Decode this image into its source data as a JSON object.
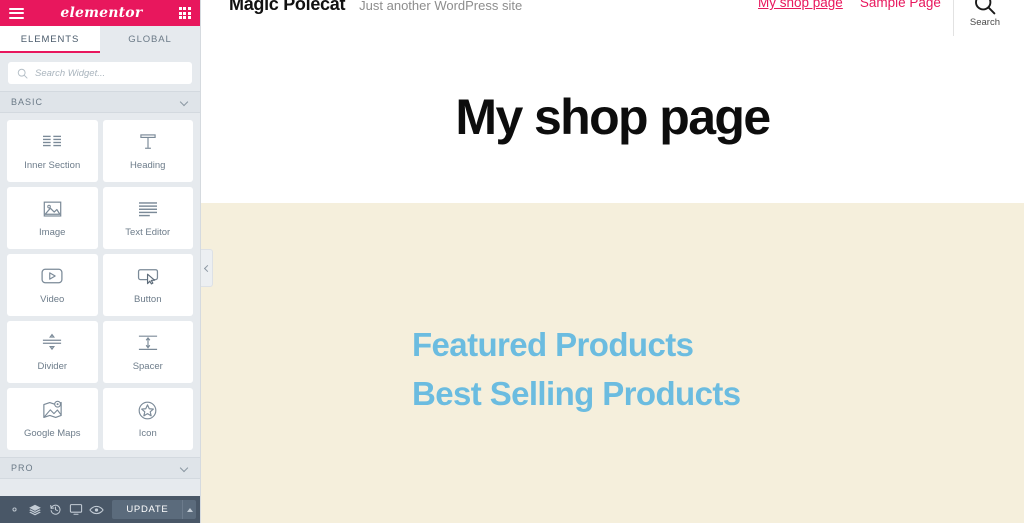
{
  "panel": {
    "brand": "elementor",
    "menu_icon": "hamburger-icon",
    "apps_icon": "grid-apps-icon",
    "tabs": [
      {
        "label": "ELEMENTS",
        "active": true
      },
      {
        "label": "GLOBAL",
        "active": false
      }
    ],
    "search": {
      "placeholder": "Search Widget...",
      "value": "",
      "icon": "search-icon"
    },
    "sections": [
      {
        "label": "BASIC",
        "expanded": true
      },
      {
        "label": "PRO",
        "expanded": false
      }
    ],
    "widgets": [
      {
        "label": "Inner Section",
        "icon": "inner-section-icon"
      },
      {
        "label": "Heading",
        "icon": "heading-t-icon"
      },
      {
        "label": "Image",
        "icon": "image-icon"
      },
      {
        "label": "Text Editor",
        "icon": "text-editor-icon"
      },
      {
        "label": "Video",
        "icon": "video-play-icon"
      },
      {
        "label": "Button",
        "icon": "button-cursor-icon"
      },
      {
        "label": "Divider",
        "icon": "divider-icon"
      },
      {
        "label": "Spacer",
        "icon": "spacer-icon"
      },
      {
        "label": "Google Maps",
        "icon": "google-maps-icon"
      },
      {
        "label": "Icon",
        "icon": "star-circle-icon"
      }
    ],
    "footer": {
      "buttons": [
        {
          "name": "settings-gear-icon",
          "title": "Settings"
        },
        {
          "name": "navigator-layers-icon",
          "title": "Navigator"
        },
        {
          "name": "history-revisions-icon",
          "title": "History"
        },
        {
          "name": "responsive-mode-icon",
          "title": "Responsive Mode"
        },
        {
          "name": "preview-eye-icon",
          "title": "Preview Changes"
        }
      ],
      "update_label": "UPDATE",
      "update_caret_icon": "caret-up-icon"
    },
    "collapse_handle_icon": "chevron-left-icon"
  },
  "preview": {
    "site_title": "Magic Polecat",
    "tagline": "Just another WordPress site",
    "nav": [
      {
        "label": "My shop page",
        "current": true
      },
      {
        "label": "Sample Page",
        "current": false
      }
    ],
    "search": {
      "label": "Search",
      "icon": "search-magnifier-icon"
    },
    "page_title": "My shop page",
    "product_headings": [
      "Featured Products",
      "Best Selling Products"
    ]
  },
  "colors": {
    "brand_pink": "#e8175d",
    "panel_bg": "#e6eaee",
    "footer_bg": "#495767",
    "beige_section": "#f5efdc",
    "heading_blue": "#6bbce0",
    "tagline_grey": "#8d8d8d"
  }
}
